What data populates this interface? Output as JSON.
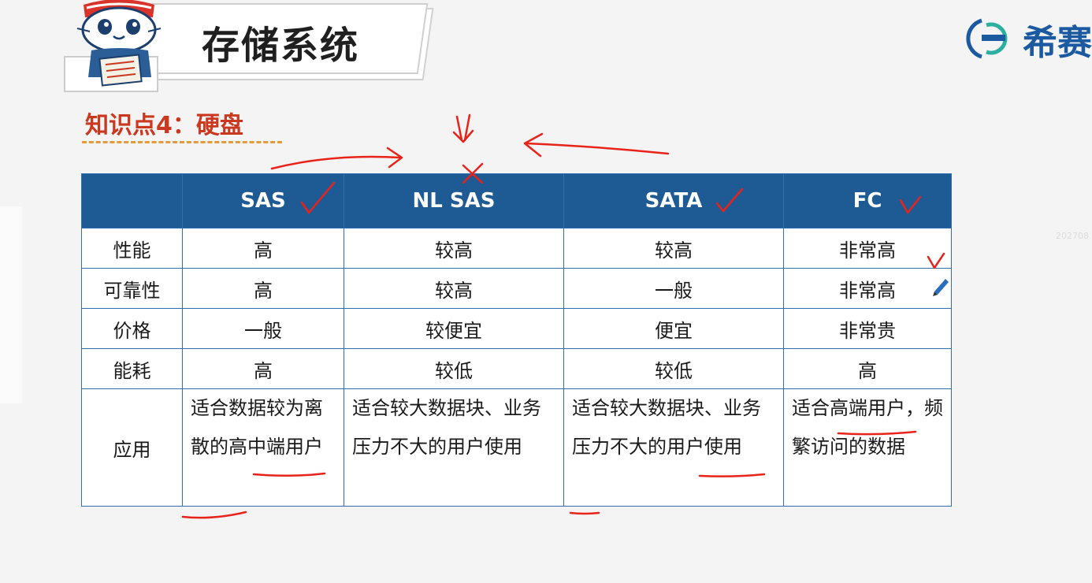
{
  "header": {
    "title": "存储系统",
    "logo_text": "希赛"
  },
  "knowledge": {
    "heading": "知识点4：硬盘"
  },
  "watermark": "202708",
  "table": {
    "columns": [
      "",
      "SAS",
      "NL SAS",
      "SATA",
      "FC"
    ],
    "rows": [
      {
        "label": "性能",
        "values": [
          "高",
          "较高",
          "较高",
          "非常高"
        ]
      },
      {
        "label": "可靠性",
        "values": [
          "高",
          "较高",
          "一般",
          "非常高"
        ]
      },
      {
        "label": "价格",
        "values": [
          "一般",
          "较便宜",
          "便宜",
          "非常贵"
        ]
      },
      {
        "label": "能耗",
        "values": [
          "高",
          "较低",
          "较低",
          "高"
        ]
      },
      {
        "label": "应用",
        "values": [
          "适合数据较为离散的高中端用户",
          "适合较大数据块、业务压力不大的用户使用",
          "适合较大数据块、业务压力不大的用户使用",
          "适合高端用户，频繁访问的数据"
        ]
      }
    ]
  },
  "colors": {
    "header_bg": "#1e5a93",
    "accent_red": "#c9381f",
    "annotation_red": "#e8231a",
    "border": "#2f6fb0"
  }
}
